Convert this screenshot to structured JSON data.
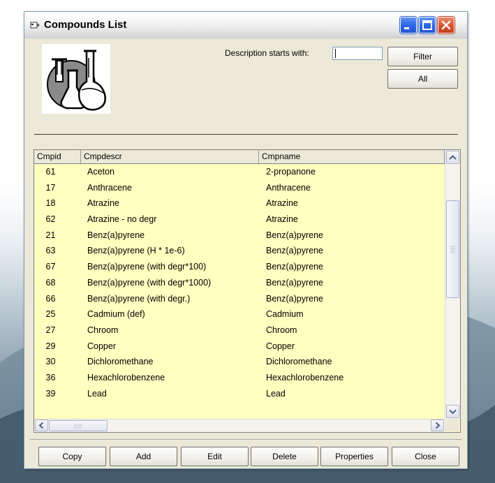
{
  "window": {
    "title": "Compounds List"
  },
  "filter": {
    "label": "Description starts with:",
    "value": "",
    "filter_button": "Filter",
    "all_button": "All"
  },
  "grid": {
    "columns": [
      "Cmpid",
      "Cmpdescr",
      "Cmpname"
    ],
    "rows": [
      {
        "id": "61",
        "descr": "Aceton",
        "name": "2-propanone"
      },
      {
        "id": "17",
        "descr": "Anthracene",
        "name": "Anthracene"
      },
      {
        "id": "18",
        "descr": "Atrazine",
        "name": "Atrazine"
      },
      {
        "id": "62",
        "descr": "Atrazine - no degr",
        "name": "Atrazine"
      },
      {
        "id": "21",
        "descr": "Benz(a)pyrene",
        "name": "Benz(a)pyrene"
      },
      {
        "id": "63",
        "descr": "Benz(a)pyrene (H * 1e-6)",
        "name": "Benz(a)pyrene"
      },
      {
        "id": "67",
        "descr": "Benz(a)pyrene (with degr*100)",
        "name": "Benz(a)pyrene"
      },
      {
        "id": "68",
        "descr": "Benz(a)pyrene (with degr*1000)",
        "name": "Benz(a)pyrene"
      },
      {
        "id": "66",
        "descr": "Benz(a)pyrene (with degr.)",
        "name": "Benz(a)pyrene"
      },
      {
        "id": "25",
        "descr": "Cadmium (def)",
        "name": "Cadmium"
      },
      {
        "id": "27",
        "descr": "Chroom",
        "name": "Chroom"
      },
      {
        "id": "29",
        "descr": "Copper",
        "name": "Copper"
      },
      {
        "id": "30",
        "descr": "Dichloromethane",
        "name": "Dichloromethane"
      },
      {
        "id": "36",
        "descr": "Hexachlorobenzene",
        "name": "Hexachlorobenzene"
      },
      {
        "id": "39",
        "descr": "Lead",
        "name": "Lead"
      }
    ]
  },
  "buttons": {
    "copy": "Copy",
    "add": "Add",
    "edit": "Edit",
    "delete": "Delete",
    "properties": "Properties",
    "close": "Close"
  },
  "colors": {
    "grid_background": "#ffffc0",
    "window_background": "#ece9d8",
    "close_button": "#d9532c",
    "title_button": "#2a63e6"
  },
  "icons": [
    "app-icon",
    "minimize-icon",
    "maximize-icon",
    "close-icon",
    "chemistry-flasks-icon",
    "scroll-up-icon",
    "scroll-down-icon",
    "scroll-left-icon",
    "scroll-right-icon"
  ]
}
